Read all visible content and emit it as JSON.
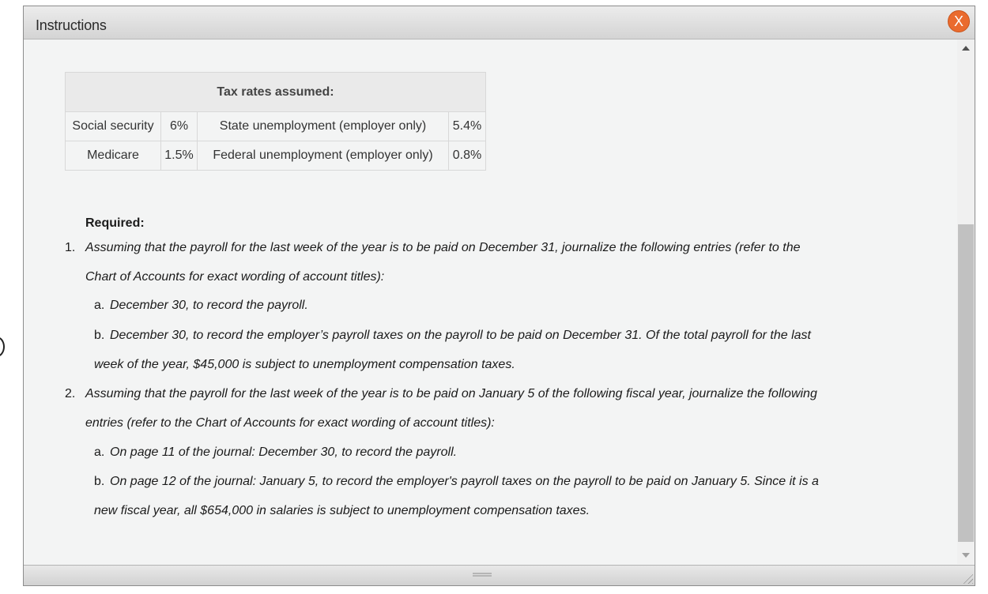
{
  "dialog": {
    "title": "Instructions",
    "close_label": "X"
  },
  "rates_table": {
    "heading": "Tax rates assumed:",
    "rows": [
      {
        "tax": "Social security",
        "rate": "6%",
        "tax2": "State unemployment (employer only)",
        "rate2": "5.4%"
      },
      {
        "tax": "Medicare",
        "rate": "1.5%",
        "tax2": "Federal unemployment (employer only)",
        "rate2": "0.8%"
      }
    ]
  },
  "required": {
    "heading": "Required:",
    "item1": {
      "number": "1.",
      "line1": "Assuming that the payroll for the last week of the year is to be paid on December 31, journalize the following entries (refer to the",
      "line2": "Chart of Accounts for exact wording of account titles):",
      "a_marker": "a.",
      "a": "December 30, to record the payroll.",
      "b_marker": "b.",
      "b_line1": "December 30, to record the employer’s payroll taxes on the payroll to be paid on December 31. Of the total payroll for the last",
      "b_line2": "week of the year, $45,000 is subject to unemployment compensation taxes."
    },
    "item2": {
      "number": "2.",
      "line1": "Assuming that the payroll for the last week of the year is to be paid on January 5 of the following fiscal year, journalize the following",
      "line2": "entries (refer to the Chart of Accounts for exact wording of account titles):",
      "a_marker": "a.",
      "a": "On page 11 of the journal: December 30, to record the payroll.",
      "b_marker": "b.",
      "b_line1": "On page 12 of the journal: January 5, to record the employer's payroll taxes on the payroll to be paid on January 5. Since it is a",
      "b_line2": "new fiscal year, all $654,000 in salaries is subject to unemployment compensation taxes."
    }
  }
}
